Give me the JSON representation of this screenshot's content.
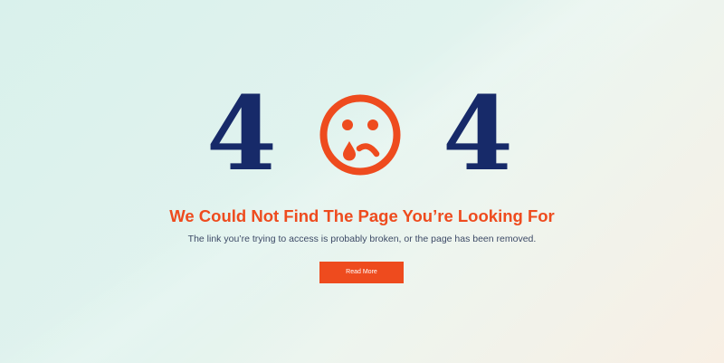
{
  "error": {
    "code_left": "4",
    "code_right": "4",
    "face_icon": "sad-face-with-tear-icon"
  },
  "message": {
    "heading": "We Could Not Find The Page You’re Looking For",
    "body": "The link you’re trying to access is probably broken, or the page has been removed."
  },
  "button": {
    "label": "Read More"
  },
  "colors": {
    "navy": "#172a69",
    "accent": "#ee4b1e",
    "body_text": "#3d4a66",
    "button_text": "#ffffff"
  }
}
